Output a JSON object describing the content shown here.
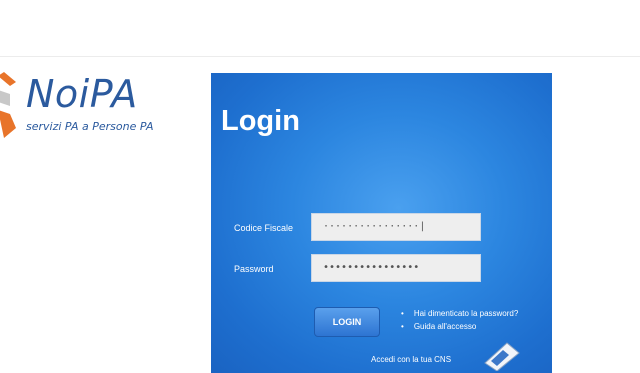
{
  "logo": {
    "name": "NoiPA",
    "tagline": "servizi PA a Persone PA"
  },
  "login": {
    "title": "Login",
    "codice_label": "Codice Fiscale",
    "codice_value": "················|",
    "password_label": "Password",
    "password_value": "••••••••••••••••",
    "button_label": "LOGIN",
    "links": [
      "Hai dimenticato la password?",
      "Guida all'accesso"
    ],
    "cns_text": "Accedi con la tua CNS"
  },
  "colors": {
    "brand_blue": "#2b5a9e",
    "panel_blue": "#2c86e0"
  }
}
